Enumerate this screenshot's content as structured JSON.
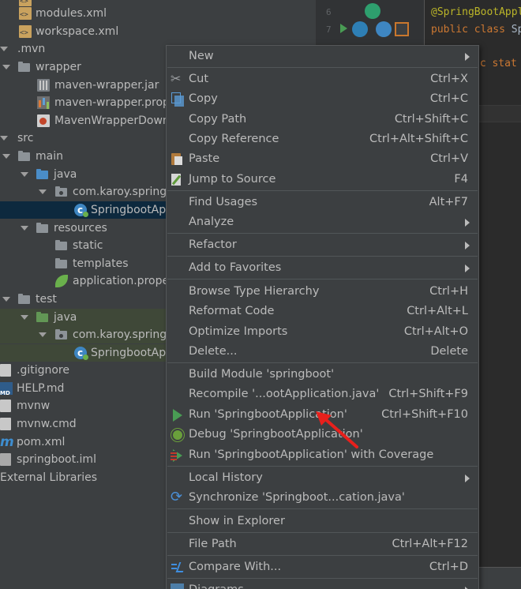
{
  "tree": {
    "rows": [
      {
        "label": "modules.xml"
      },
      {
        "label": "workspace.xml"
      },
      {
        "label": ".mvn"
      },
      {
        "label": "wrapper"
      },
      {
        "label": "maven-wrapper.jar"
      },
      {
        "label": "maven-wrapper.prop"
      },
      {
        "label": "MavenWrapperDown"
      },
      {
        "label": "src"
      },
      {
        "label": "main"
      },
      {
        "label": "java"
      },
      {
        "label": "com.karoy.spring"
      },
      {
        "label": "SpringbootAp"
      },
      {
        "label": "resources"
      },
      {
        "label": "static"
      },
      {
        "label": "templates"
      },
      {
        "label": "application.prope"
      },
      {
        "label": "test"
      },
      {
        "label": "java"
      },
      {
        "label": "com.karoy.spring"
      },
      {
        "label": "SpringbootAp"
      },
      {
        "label": ".gitignore"
      },
      {
        "label": "HELP.md"
      },
      {
        "label": "mvnw"
      },
      {
        "label": "mvnw.cmd"
      },
      {
        "label": "pom.xml"
      },
      {
        "label": "springboot.iml"
      },
      {
        "label": "External Libraries"
      }
    ]
  },
  "editor": {
    "line_numbers": [
      "6",
      "7"
    ],
    "line6_code": "@SpringBootAppl",
    "line7_kw": "public class ",
    "line7_rest": "Sp",
    "line8_code": "ic stat"
  },
  "menu": {
    "items": [
      {
        "label": "New",
        "shortcut": ""
      },
      {
        "label": "Cut",
        "shortcut": "Ctrl+X"
      },
      {
        "label": "Copy",
        "shortcut": "Ctrl+C"
      },
      {
        "label": "Copy Path",
        "shortcut": "Ctrl+Shift+C"
      },
      {
        "label": "Copy Reference",
        "shortcut": "Ctrl+Alt+Shift+C"
      },
      {
        "label": "Paste",
        "shortcut": "Ctrl+V"
      },
      {
        "label": "Jump to Source",
        "shortcut": "F4"
      },
      {
        "label": "Find Usages",
        "shortcut": "Alt+F7"
      },
      {
        "label": "Analyze",
        "shortcut": ""
      },
      {
        "label": "Refactor",
        "shortcut": ""
      },
      {
        "label": "Add to Favorites",
        "shortcut": ""
      },
      {
        "label": "Browse Type Hierarchy",
        "shortcut": "Ctrl+H"
      },
      {
        "label": "Reformat Code",
        "shortcut": "Ctrl+Alt+L"
      },
      {
        "label": "Optimize Imports",
        "shortcut": "Ctrl+Alt+O"
      },
      {
        "label": "Delete...",
        "shortcut": "Delete"
      },
      {
        "label": "Build Module 'springboot'",
        "shortcut": ""
      },
      {
        "label": "Recompile '...ootApplication.java'",
        "shortcut": "Ctrl+Shift+F9"
      },
      {
        "label": "Run 'SpringbootApplication'",
        "shortcut": "Ctrl+Shift+F10"
      },
      {
        "label": "Debug 'SpringbootApplication'",
        "shortcut": ""
      },
      {
        "label": "Run 'SpringbootApplication' with Coverage",
        "shortcut": ""
      },
      {
        "label": "Local History",
        "shortcut": ""
      },
      {
        "label": "Synchronize 'Springboot...cation.java'",
        "shortcut": ""
      },
      {
        "label": "Show in Explorer",
        "shortcut": ""
      },
      {
        "label": "File Path",
        "shortcut": "Ctrl+Alt+F12"
      },
      {
        "label": "Compare With...",
        "shortcut": "Ctrl+D"
      },
      {
        "label": "Diagrams",
        "shortcut": ""
      }
    ]
  },
  "colors": {
    "tree_bg": "#3c3f41",
    "selection": "#0d293e",
    "menu_bg": "#3c3f41",
    "annotation_arrow": "#e8201c"
  }
}
